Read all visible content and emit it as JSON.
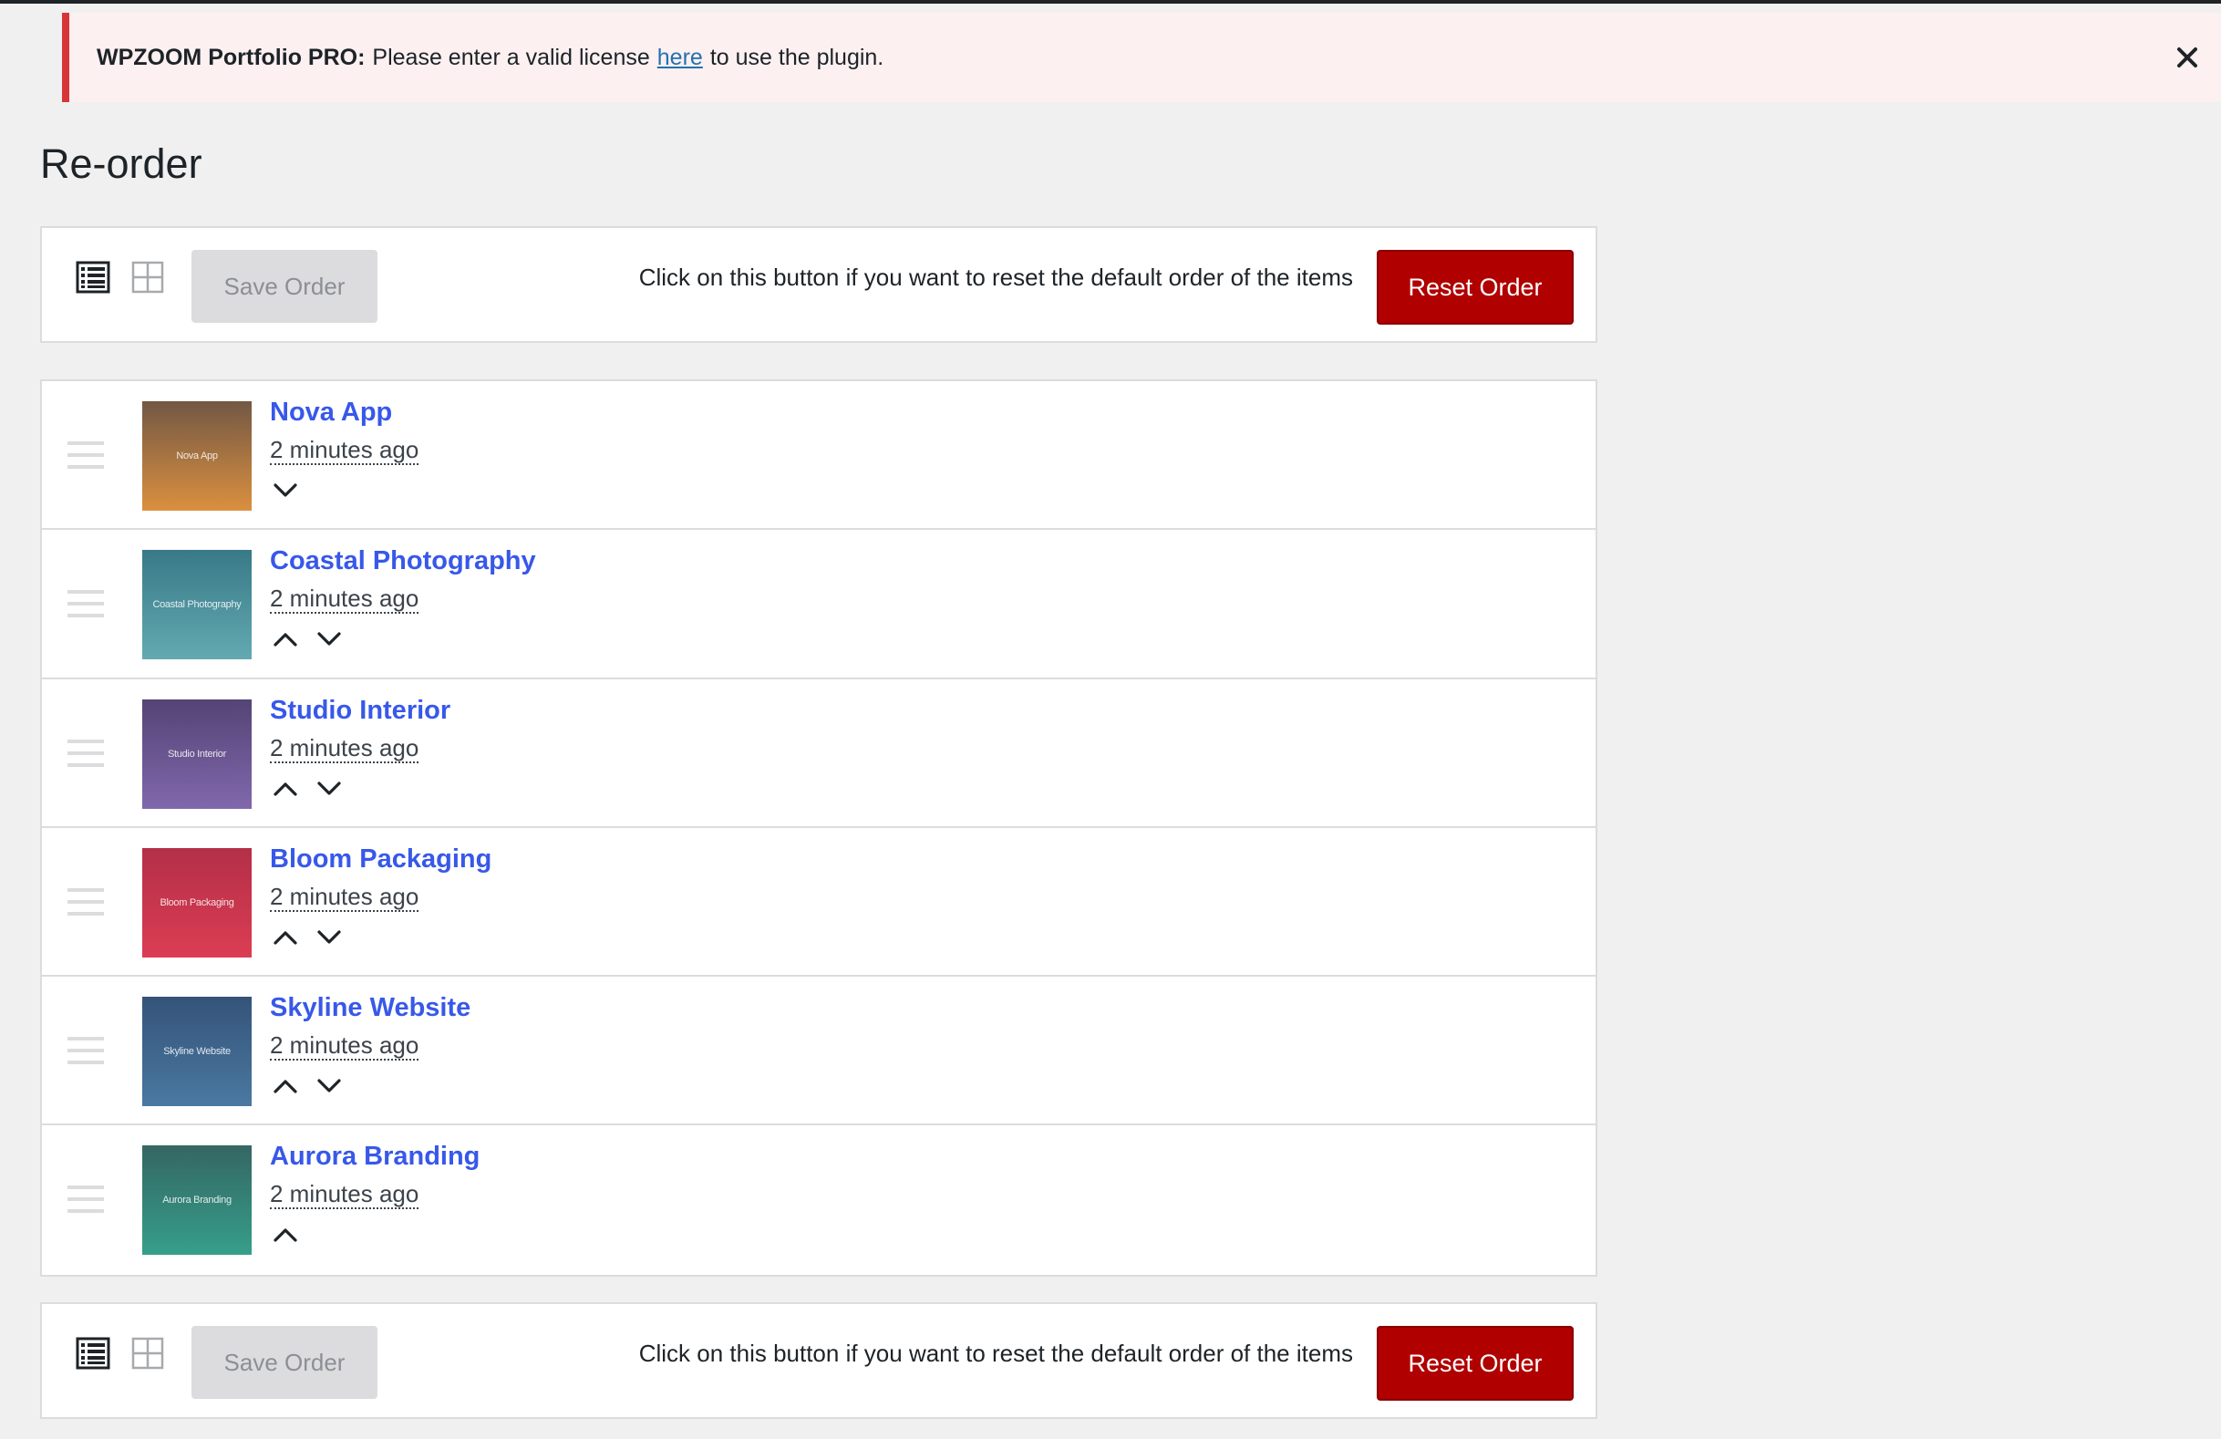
{
  "notice": {
    "plugin": "WPZOOM Portfolio PRO:",
    "message_before": "Please enter a valid license",
    "link_text": "here",
    "message_after": "to use the plugin."
  },
  "page": {
    "title": "Re-order"
  },
  "toolbar": {
    "save_label": "Save Order",
    "help_text": "Click on this button if you want to reset the default order of the items",
    "reset_label": "Reset Order",
    "view_modes": [
      "list-view-icon",
      "grid-view-icon"
    ],
    "active_view": "list"
  },
  "items": [
    {
      "title": "Nova App",
      "date": "2 minutes ago",
      "thumb_text": "Nova App",
      "color_top": "#6b4f3a",
      "color_bottom": "#d98a36",
      "can_up": false,
      "can_down": true
    },
    {
      "title": "Coastal Photography",
      "date": "2 minutes ago",
      "thumb_text": "Coastal Photography",
      "color_top": "#2e7281",
      "color_bottom": "#5aa6ad",
      "can_up": true,
      "can_down": true
    },
    {
      "title": "Studio Interior",
      "date": "2 minutes ago",
      "thumb_text": "Studio Interior",
      "color_top": "#4b3a6e",
      "color_bottom": "#7a60a8",
      "can_up": true,
      "can_down": true
    },
    {
      "title": "Bloom Packaging",
      "date": "2 minutes ago",
      "thumb_text": "Bloom Packaging",
      "color_top": "#b0253e",
      "color_bottom": "#d9334a",
      "can_up": true,
      "can_down": true
    },
    {
      "title": "Skyline Website",
      "date": "2 minutes ago",
      "thumb_text": "Skyline Website",
      "color_top": "#2a4a72",
      "color_bottom": "#41729c",
      "can_up": true,
      "can_down": true
    },
    {
      "title": "Aurora Branding",
      "date": "2 minutes ago",
      "thumb_text": "Aurora Branding",
      "color_top": "#2b5e5c",
      "color_bottom": "#2b9a84",
      "can_up": true,
      "can_down": false
    }
  ],
  "colors": {
    "accent_link": "#3858e9",
    "reset_button": "#b00000",
    "notice_border": "#d63638",
    "notice_bg": "#fcf0f1"
  }
}
